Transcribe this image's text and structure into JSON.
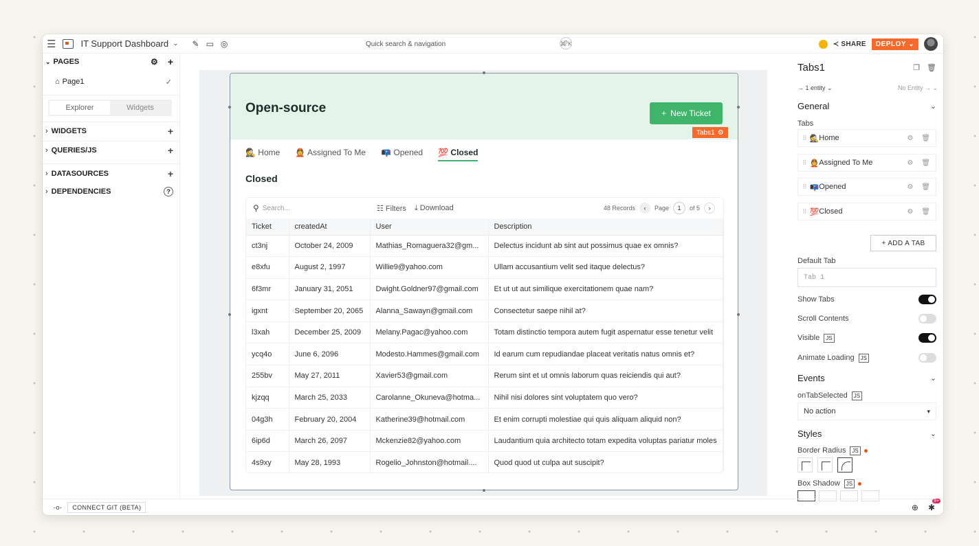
{
  "topbar": {
    "app_title": "IT Support Dashboard",
    "search_placeholder": "Quick search & navigation",
    "search_shortcut": "⌘ K",
    "help": "?",
    "share_label": "SHARE",
    "deploy_label": "DEPLOY",
    "accent_color": "#f86a2b"
  },
  "sidebar": {
    "pages_header": "PAGES",
    "page1": "Page1",
    "tab_explorer": "Explorer",
    "tab_widgets": "Widgets",
    "sections": [
      "WIDGETS",
      "QUERIES/JS",
      "DATASOURCES",
      "DEPENDENCIES"
    ]
  },
  "widget": {
    "title": "Open-source",
    "new_ticket": "New Ticket",
    "tabs_label": "Tabs1",
    "tabs": [
      "Home",
      "Assigned To Me",
      "Opened",
      "Closed"
    ],
    "tab_icons": [
      "🕵",
      "👲",
      "📭",
      "💯"
    ],
    "active_tab": "Closed",
    "subtitle": "Closed",
    "accent_color": "#3fb56b"
  },
  "table": {
    "search_placeholder": "Search...",
    "filters": "Filters",
    "download": "Download",
    "records": "48 Records",
    "page_label": "Page",
    "page": "1",
    "of": "of 5",
    "columns": [
      "Ticket",
      "createdAt",
      "User",
      "Description"
    ],
    "rows": [
      [
        "ct3nj",
        "October 24, 2009",
        "Mathias_Romaguera32@gm...",
        "Delectus incidunt ab sint aut possimus quae ex omnis?"
      ],
      [
        "e8xfu",
        "August 2, 1997",
        "Willie9@yahoo.com",
        "Ullam accusantium velit sed itaque delectus?"
      ],
      [
        "6f3mr",
        "January 31, 2051",
        "Dwight.Goldner97@gmail.com",
        "Et ut ut aut similique exercitationem quae nam?"
      ],
      [
        "igxnt",
        "September 20, 2065",
        "Alanna_Sawayn@gmail.com",
        "Consectetur saepe nihil at?"
      ],
      [
        "l3xah",
        "December 25, 2009",
        "Melany.Pagac@yahoo.com",
        "Totam distinctio tempora autem fugit aspernatur esse tenetur velit"
      ],
      [
        "ycq4o",
        "June 6, 2096",
        "Modesto.Hammes@gmail.com",
        "Id earum cum repudiandae placeat veritatis natus omnis et?"
      ],
      [
        "255bv",
        "May 27, 2011",
        "Xavier53@gmail.com",
        "Rerum sint et ut omnis laborum quas reiciendis qui aut?"
      ],
      [
        "kjzqq",
        "March 25, 2033",
        "Carolanne_Okuneva@hotma...",
        "Nihil nisi dolores sint voluptatem quo vero?"
      ],
      [
        "04g3h",
        "February 20, 2004",
        "Katherine39@hotmail.com",
        "Et enim corrupti molestiae qui quis aliquam aliquid non?"
      ],
      [
        "6ip6d",
        "March 26, 2097",
        "Mckenzie82@yahoo.com",
        "Laudantium quia architecto totam expedita voluptas pariatur moles"
      ],
      [
        "4s9xy",
        "May 28, 1993",
        "Rogelio_Johnston@hotmail....",
        "Quod quod ut culpa aut suscipit?"
      ]
    ]
  },
  "panel": {
    "title": "Tabs1",
    "entity": "→ 1 entity ⌄",
    "no_entity": "No Entity → ⌄",
    "general": "General",
    "tabs_label": "Tabs",
    "tab_items": [
      "Home",
      "Assigned To Me",
      "Opened",
      "Closed"
    ],
    "tab_item_icons": [
      "🕵",
      "👲",
      "📭",
      "💯"
    ],
    "add_tab": "+ ADD A TAB",
    "default_tab_label": "Default Tab",
    "default_tab_placeholder": "Tab 1",
    "show_tabs": "Show Tabs",
    "scroll_contents": "Scroll Contents",
    "visible": "Visible",
    "animate_loading": "Animate Loading",
    "js": "JS",
    "events": "Events",
    "on_tab_selected": "onTabSelected",
    "no_action": "No action",
    "styles": "Styles",
    "border_radius": "Border Radius",
    "box_shadow": "Box Shadow",
    "toggles": {
      "show_tabs": true,
      "scroll_contents": false,
      "visible": true,
      "animate_loading": false
    }
  },
  "bottombar": {
    "connect_git": "CONNECT GIT (BETA)",
    "bug_count": "9+"
  }
}
